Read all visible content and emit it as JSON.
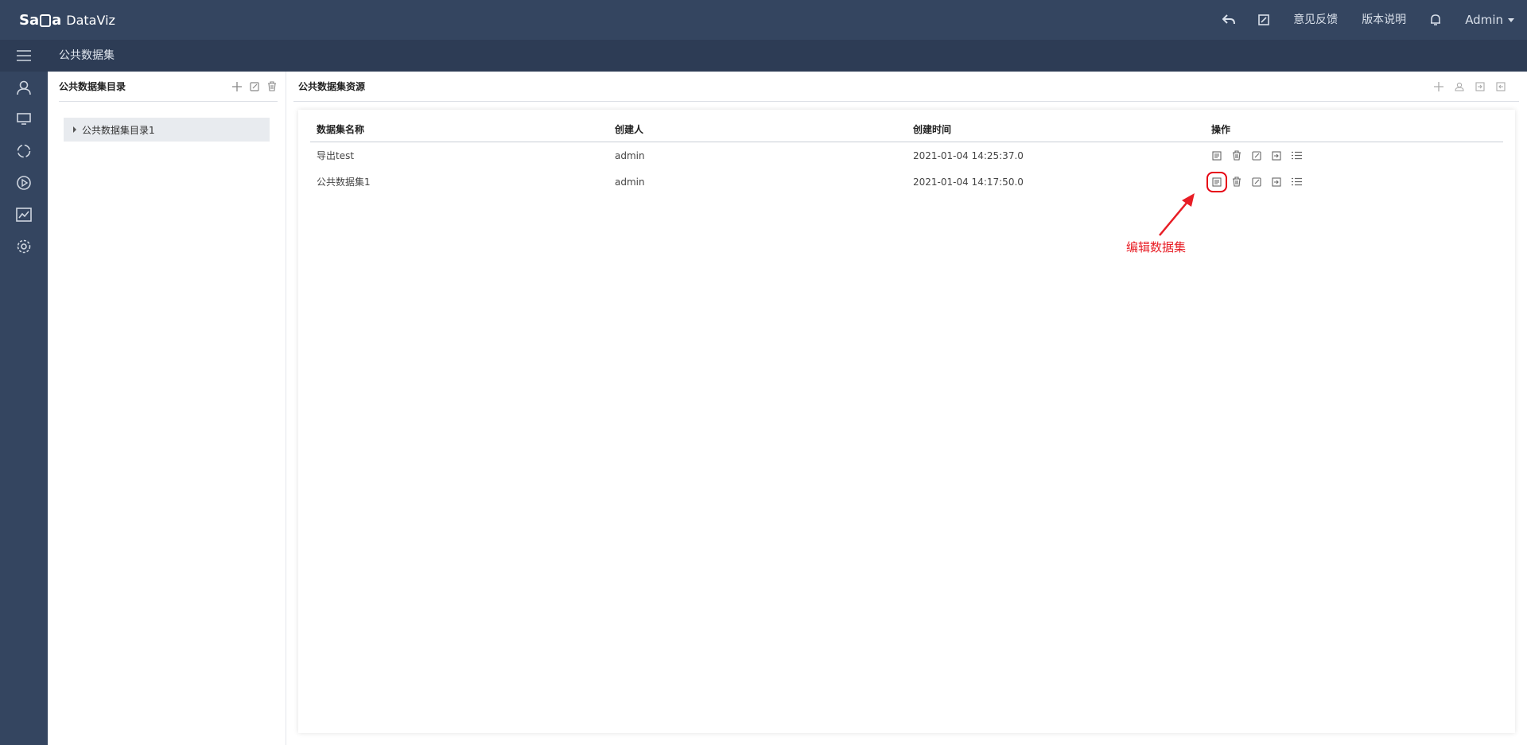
{
  "header": {
    "logo_mark_left": "Sa",
    "logo_mark_right": "a",
    "product_name": "DataViz",
    "feedback_label": "意见反馈",
    "release_notes_label": "版本说明",
    "user_label": "Admin"
  },
  "subbar": {
    "breadcrumb": "公共数据集"
  },
  "rail": {
    "icons": [
      "user-icon",
      "monitor-icon",
      "cycle-icon",
      "play-icon",
      "chart-icon",
      "settings-icon"
    ]
  },
  "directory_panel": {
    "title": "公共数据集目录",
    "tree": [
      {
        "label": "公共数据集目录1"
      }
    ]
  },
  "resource_panel": {
    "title": "公共数据集资源",
    "table": {
      "columns": [
        "数据集名称",
        "创建人",
        "创建时间",
        "操作"
      ],
      "rows": [
        {
          "name": "导出test",
          "creator": "admin",
          "created_at": "2021-01-04 14:25:37.0"
        },
        {
          "name": "公共数据集1",
          "creator": "admin",
          "created_at": "2021-01-04 14:17:50.0"
        }
      ],
      "row_actions": [
        "edit-dataset-icon",
        "delete-icon",
        "edit-icon",
        "import-icon",
        "list-icon"
      ]
    }
  },
  "annotation": {
    "text": "编辑数据集",
    "color": "#e81d25"
  },
  "colors": {
    "topbar": "#344560",
    "subbar": "#2d3c55",
    "accent_red": "#e60012"
  }
}
